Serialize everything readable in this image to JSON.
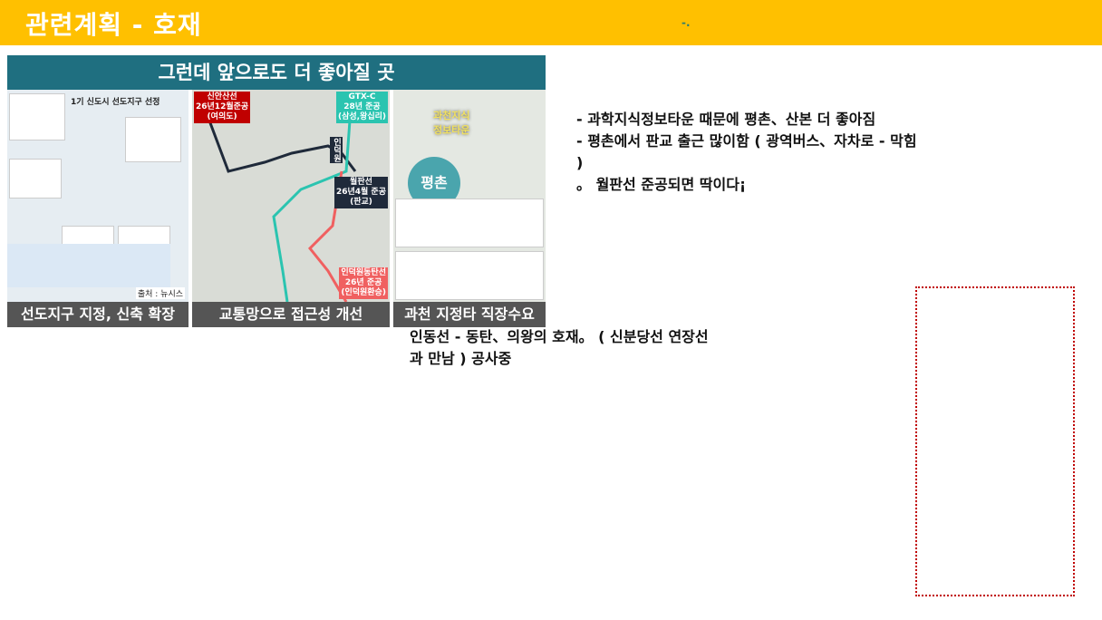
{
  "header": {
    "title": "관련계획 - 호재",
    "mark": "-."
  },
  "figure": {
    "heading": "그런데 앞으로도 더 좋아질 곳",
    "panel1": {
      "title": "1기 신도시 선도지구 선정",
      "source": "출처 : 뉴시스",
      "caption": "선도지구 지정, 신축 확장"
    },
    "panel2": {
      "caption": "교통망으로 접근성 개선",
      "labels": [
        "신안산선\n26년12월준공\n(여의도)",
        "GTX-C\n28년 준공\n(삼성,왕십리)",
        "인덕원",
        "월판선\n26년4월 준공\n(판교)",
        "인덕원동탄선\n26년 준공\n(인덕원환승)"
      ]
    },
    "panel3": {
      "caption": "과천 지정타 직장수요",
      "town": "과천지식\n정보타운",
      "circle": "평촌"
    }
  },
  "notes": {
    "lines": [
      " - 과학지식정보타운 때문에 평촌、산본 더 좋아짐",
      " - 평촌에서 판교 출근 많이함 ( 광역버스、자차로 - 막힘 )",
      "。 월판선 준공되면 딱이다¡"
    ],
    "second": "인동선 - 동탄、의왕의 호재。 ( 신분당선 연장선과 만남 ) 공사중"
  },
  "colors": {
    "accent": "#ffc000",
    "teal": "#1f6f80",
    "dotted_border": "#c00000"
  }
}
